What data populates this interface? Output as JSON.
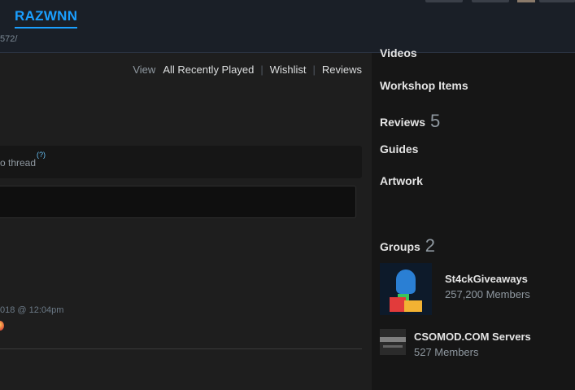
{
  "header": {
    "title": "RAZWNN",
    "url_fragment": "572/"
  },
  "main": {
    "view_label": "View",
    "view_links": [
      "All Recently Played",
      "Wishlist",
      "Reviews"
    ],
    "thread_text": "o thread",
    "help_mark": "(?)",
    "timestamp": "018 @ 12:04pm"
  },
  "sidebar": {
    "items": {
      "videos": "Videos",
      "workshop": "Workshop Items",
      "reviews": "Reviews",
      "reviews_count": "5",
      "guides": "Guides",
      "artwork": "Artwork"
    },
    "groups_label": "Groups",
    "groups_count": "2",
    "groups": [
      {
        "name": "St4ckGiveaways",
        "members": "257,200 Members"
      },
      {
        "name": "CSOMOD.COM Servers",
        "members": "527 Members"
      }
    ]
  },
  "colors": {
    "accent": "#1a9fff",
    "link": "#67c1f5"
  }
}
